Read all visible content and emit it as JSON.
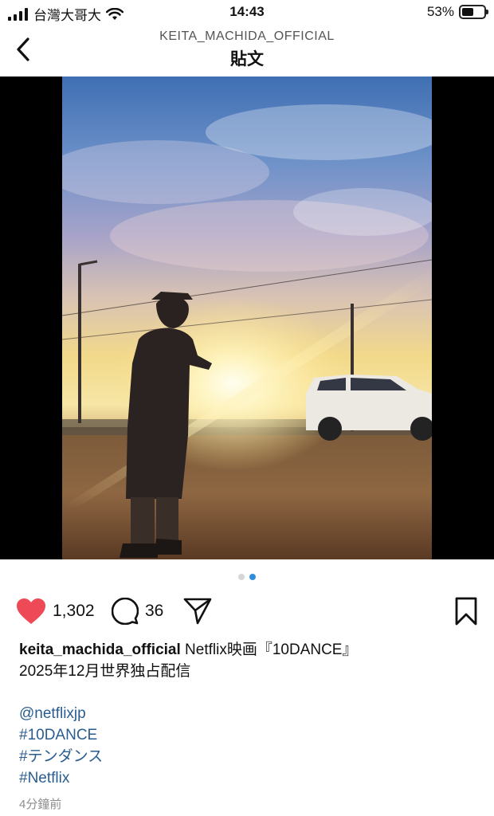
{
  "status_bar": {
    "carrier": "台灣大哥大",
    "time": "14:43",
    "battery_percent": "53%",
    "battery_level": 0.53
  },
  "header": {
    "account": "KEITA_MACHIDA_OFFICIAL",
    "title": "貼文"
  },
  "carousel": {
    "count": 2,
    "active_index": 1
  },
  "actions": {
    "likes": "1,302",
    "comments": "36",
    "liked": true,
    "like_color": "#ed4956"
  },
  "caption": {
    "username": "keita_machida_official",
    "line1": "Netflix映画『10DANCE』",
    "line2": "2025年12月世界独占配信"
  },
  "tags": [
    "@netflixjp",
    "#10DANCE",
    "#テンダンス",
    "#Netflix"
  ],
  "timestamp": "4分鐘前",
  "colors": {
    "link": "#2a5d8f",
    "dot_active": "#2f8dde"
  }
}
